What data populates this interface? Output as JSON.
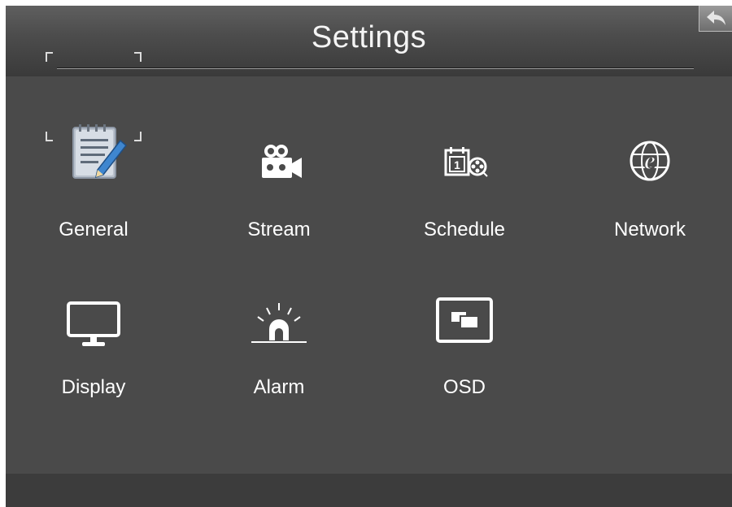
{
  "header": {
    "title": "Settings"
  },
  "back_button": {
    "icon": "back-arrow-icon"
  },
  "menu": {
    "items": [
      {
        "label": "General",
        "icon": "notepad-pen-icon",
        "selected": true
      },
      {
        "label": "Stream",
        "icon": "video-camera-icon",
        "selected": false
      },
      {
        "label": "Schedule",
        "icon": "calendar-reel-icon",
        "selected": false
      },
      {
        "label": "Network",
        "icon": "globe-e-icon",
        "selected": false
      },
      {
        "label": "Display",
        "icon": "monitor-icon",
        "selected": false
      },
      {
        "label": "Alarm",
        "icon": "siren-icon",
        "selected": false
      },
      {
        "label": "OSD",
        "icon": "osd-window-icon",
        "selected": false
      }
    ]
  },
  "colors": {
    "background": "#4a4a4a",
    "header_top": "#5f5f5f",
    "header_bottom": "#3a3a3a",
    "footer": "#3c3c3c",
    "text": "#ffffff",
    "icon_blue": "#4a90d9"
  }
}
